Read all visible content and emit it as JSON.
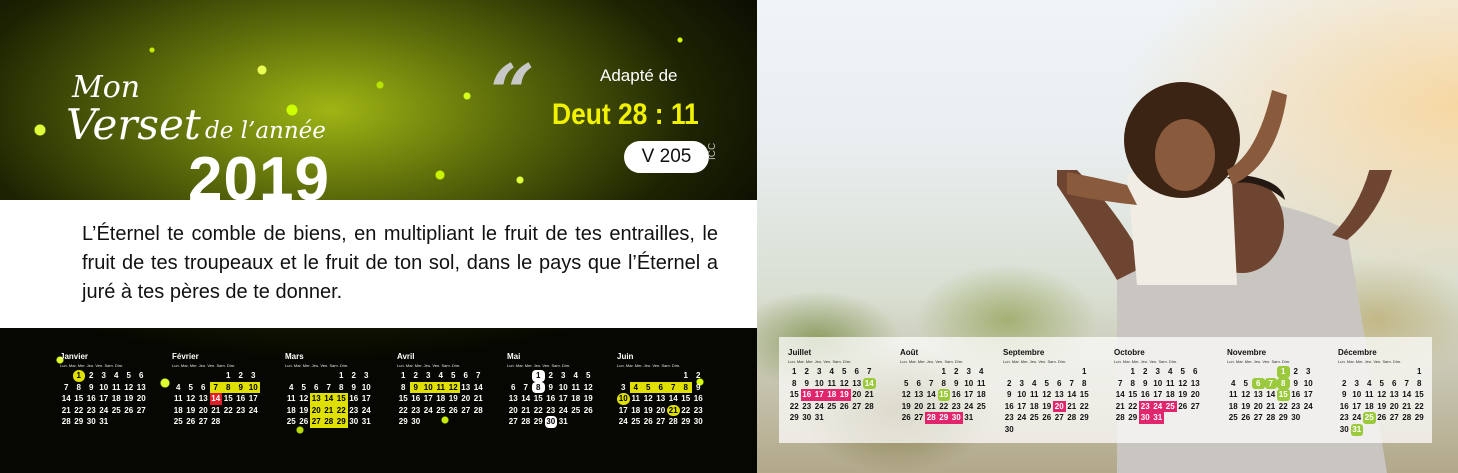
{
  "verse_card": {
    "title_mon": "Mon",
    "title_verset": "Verset",
    "title_de_lannee": "de l’année",
    "year": "2019",
    "adapted_label": "Adapté de",
    "reference": "Deut 28 : 11",
    "version": "V 205",
    "side_tag": "ICC",
    "verse_text": "L’Éternel te comble de biens, en multipliant le fruit de tes entrailles, le fruit de tes troupeaux et le fruit de ton sol, dans le pays que l’Éternel a juré à tes pères de te donner."
  },
  "weekday_header": "Lun. Mar. Mer. Jeu. Ven. Sam. Dim.",
  "colors": {
    "yellow_highlight": "#e0e000",
    "red_highlight": "#e01e28",
    "green_highlight": "#9ac93c",
    "pink_highlight": "#e2266d"
  },
  "months_left": [
    {
      "name": "Janvier",
      "offset": 1,
      "days": 31,
      "marks": {
        "1": "yc"
      }
    },
    {
      "name": "Février",
      "offset": 4,
      "days": 28,
      "marks": {
        "7": "y",
        "8": "y",
        "9": "y",
        "10": "y",
        "14": "r"
      }
    },
    {
      "name": "Mars",
      "offset": 4,
      "days": 31,
      "marks": {
        "13": "y",
        "14": "y",
        "15": "y",
        "20": "y",
        "21": "y",
        "22": "y",
        "27": "y",
        "28": "y",
        "29": "y"
      }
    },
    {
      "name": "Avril",
      "offset": 0,
      "days": 30,
      "marks": {
        "9": "y",
        "10": "y",
        "11": "y",
        "12": "y"
      }
    },
    {
      "name": "Mai",
      "offset": 2,
      "days": 31,
      "marks": {
        "1": "c",
        "8": "c",
        "30": "c"
      }
    },
    {
      "name": "Juin",
      "offset": 5,
      "days": 30,
      "marks": {
        "4": "y",
        "5": "y",
        "6": "y",
        "7": "y",
        "8": "y",
        "10": "yc",
        "21": "yc"
      }
    }
  ],
  "months_right": [
    {
      "name": "Juillet",
      "offset": 0,
      "days": 31,
      "marks": {
        "14": "g",
        "16": "p",
        "17": "p",
        "18": "p",
        "19": "p"
      }
    },
    {
      "name": "Août",
      "offset": 3,
      "days": 31,
      "marks": {
        "15": "g",
        "28": "p",
        "29": "p",
        "30": "p"
      }
    },
    {
      "name": "Septembre",
      "offset": 6,
      "days": 30,
      "marks": {
        "20": "p"
      }
    },
    {
      "name": "Octobre",
      "offset": 1,
      "days": 31,
      "marks": {
        "23": "p",
        "24": "p",
        "25": "p",
        "30": "p",
        "31": "p"
      }
    },
    {
      "name": "Novembre",
      "offset": 4,
      "days": 30,
      "marks": {
        "1": "g",
        "6": "g",
        "7": "g",
        "8": "g",
        "15": "g"
      }
    },
    {
      "name": "Décembre",
      "offset": 6,
      "days": 31,
      "marks": {
        "25": "g",
        "31": "g"
      }
    }
  ]
}
